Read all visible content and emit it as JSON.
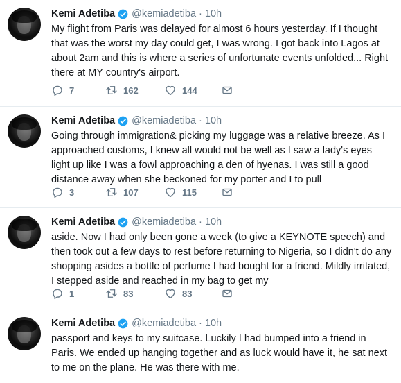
{
  "colors": {
    "verified": "#1da1f2",
    "muted": "#657786",
    "text": "#14171a",
    "border": "#e6ecf0"
  },
  "icons": {
    "reply": "reply-icon",
    "retweet": "retweet-icon",
    "like": "heart-icon",
    "dm": "envelope-icon",
    "verified": "verified-badge-icon"
  },
  "tweets": [
    {
      "name": "Kemi Adetiba",
      "handle": "@kemiadetiba",
      "time": "10h",
      "text": "My flight from Paris was delayed for almost 6 hours yesterday. If I thought that was the worst my day could get, I was wrong. I got back into Lagos at about 2am and this is where a series of unfortunate events unfolded... Right there at MY country's airport.",
      "replies": "7",
      "retweets": "162",
      "likes": "144"
    },
    {
      "name": "Kemi Adetiba",
      "handle": "@kemiadetiba",
      "time": "10h",
      "text": "Going through immigration& picking my luggage was a relative breeze. As I approached customs, I knew all would not be well as I saw a lady's eyes light up like I was a fowl approaching a den of hyenas. I was still a good distance away when she beckoned for my porter and I to pull",
      "replies": "3",
      "retweets": "107",
      "likes": "115"
    },
    {
      "name": "Kemi Adetiba",
      "handle": "@kemiadetiba",
      "time": "10h",
      "text": "aside. Now I had only been gone a week (to give a KEYNOTE speech) and then took out a few days to rest before returning to Nigeria, so I didn't do any shopping asides a bottle of perfume I had bought for a friend. Mildly irritated, I stepped aside and reached in my bag to get my",
      "replies": "1",
      "retweets": "83",
      "likes": "83"
    },
    {
      "name": "Kemi Adetiba",
      "handle": "@kemiadetiba",
      "time": "10h",
      "text": "passport and keys to my suitcase. Luckily I had bumped into a friend in Paris. We ended up hanging together and as luck would have it, he sat next to me on the plane. He was there with me."
    }
  ]
}
